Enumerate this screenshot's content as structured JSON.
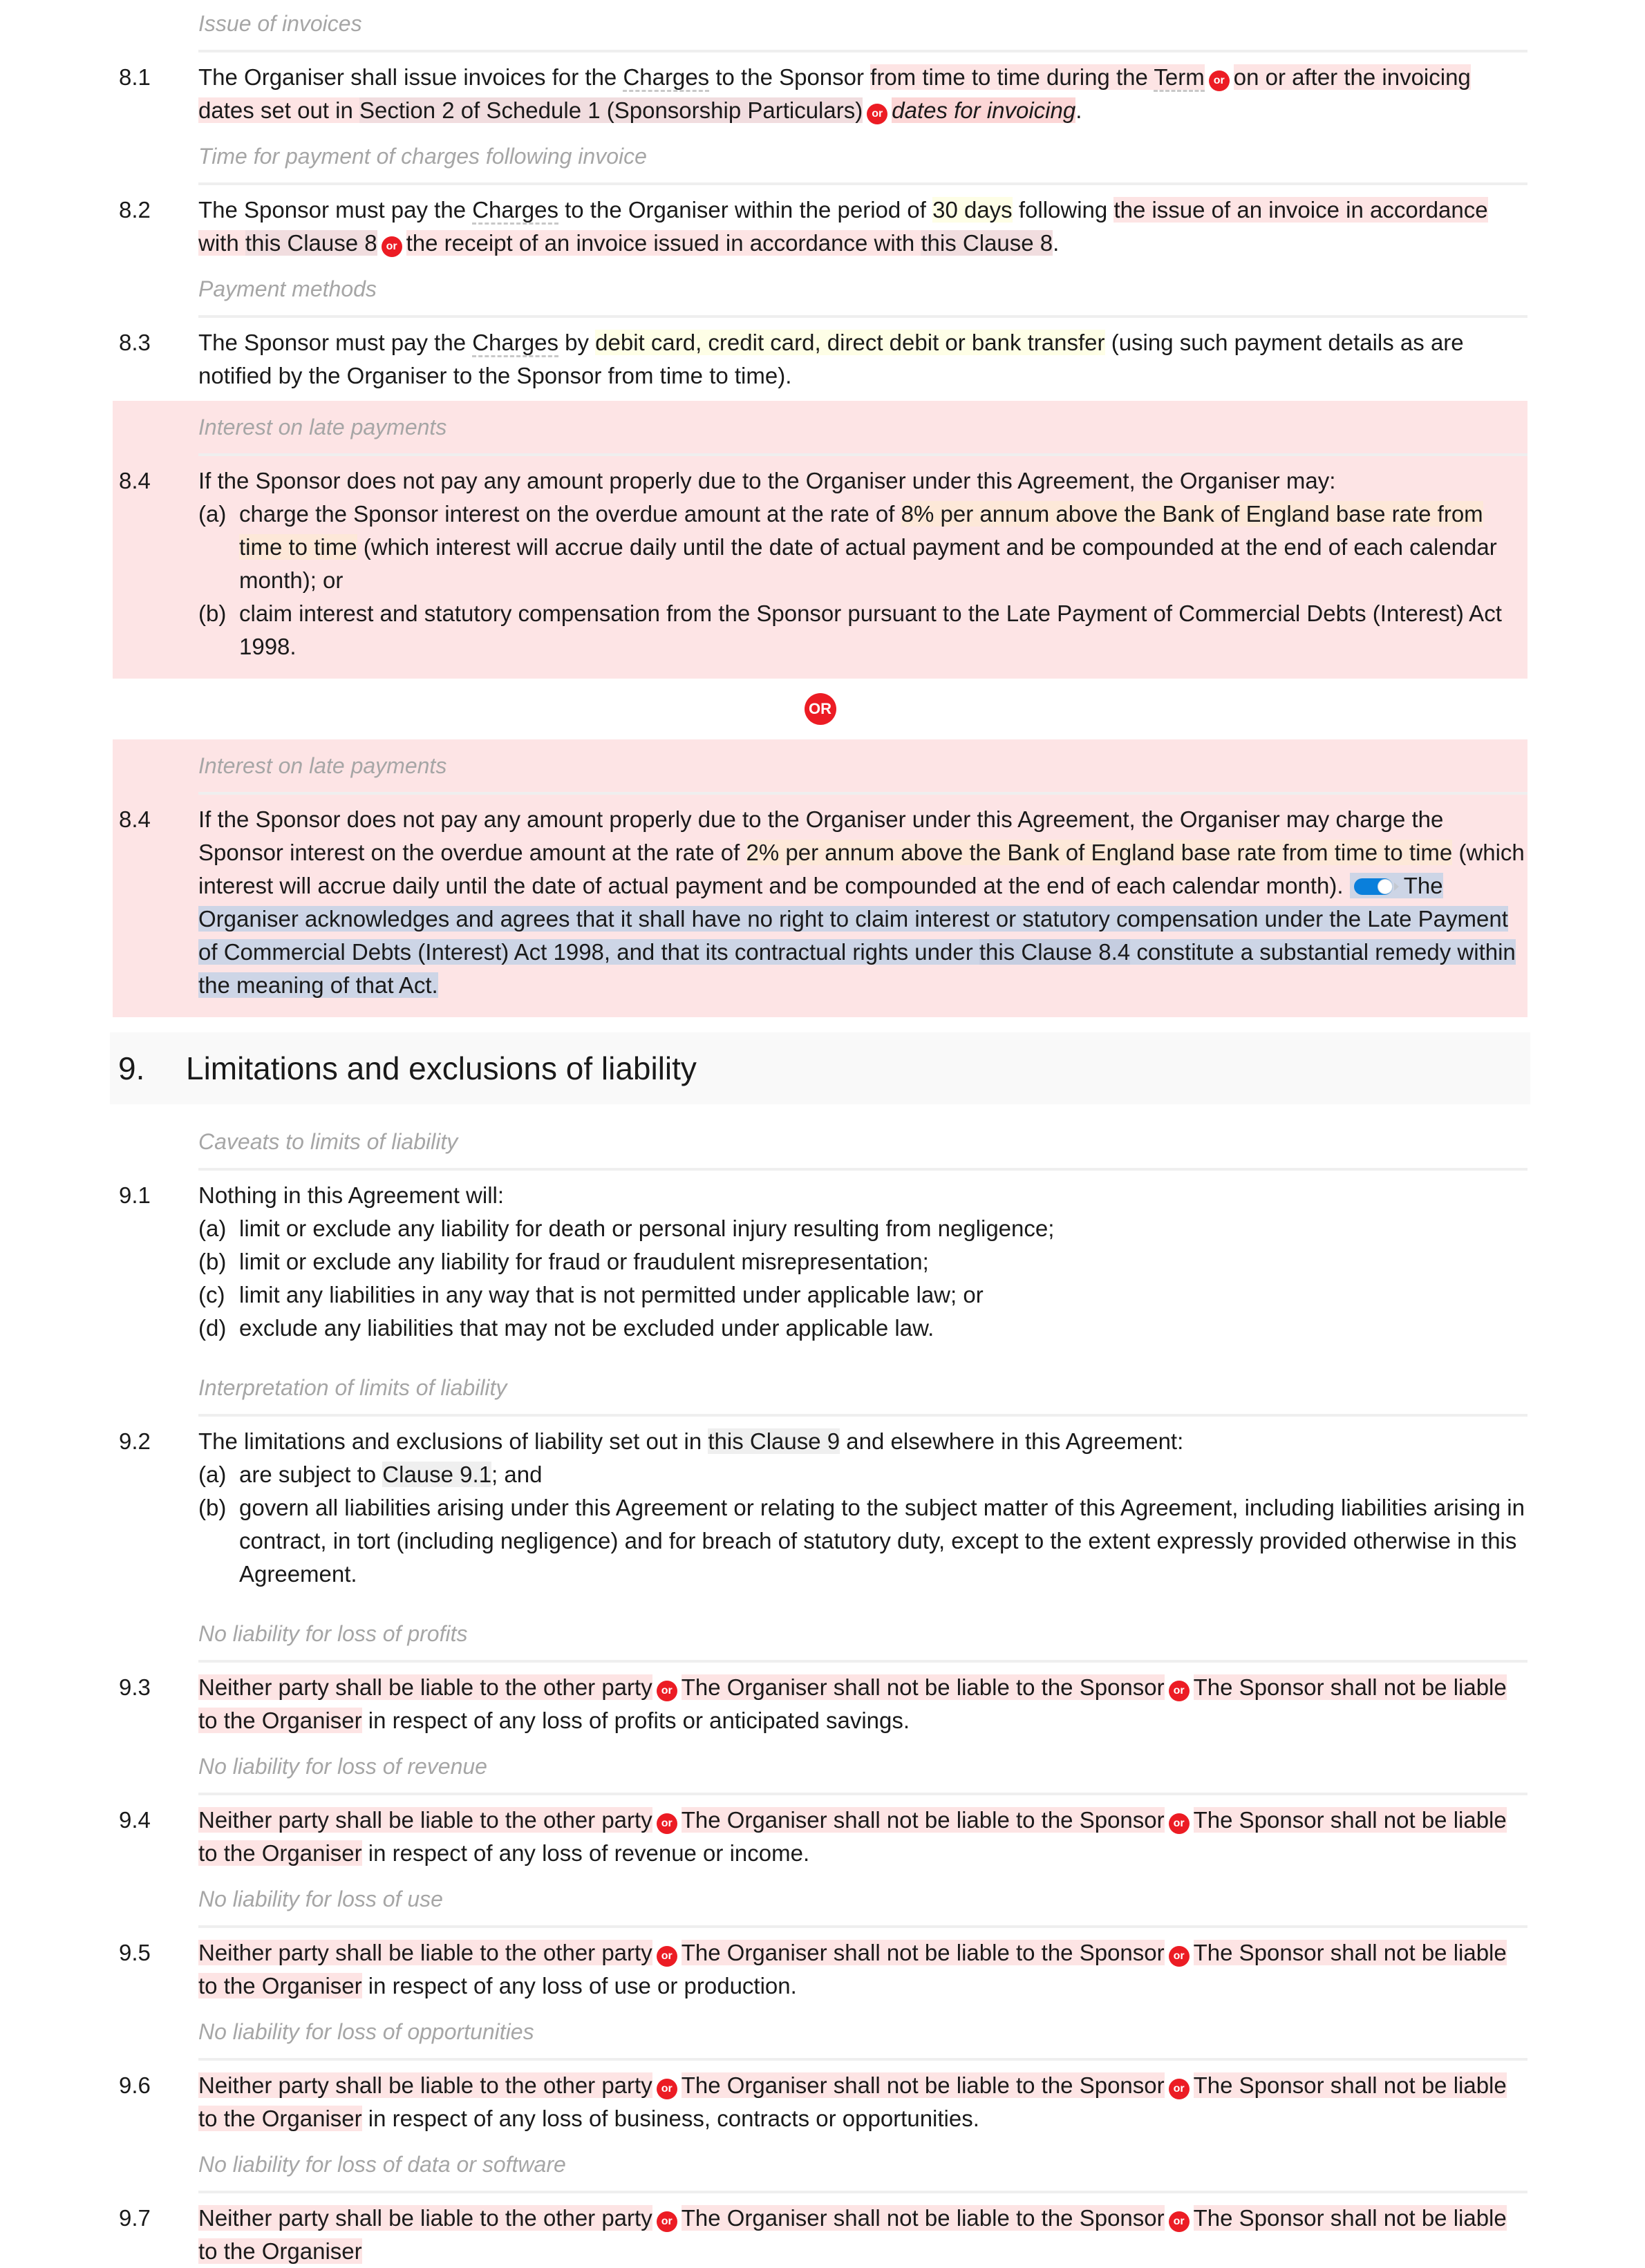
{
  "colors": {
    "option_bg": "#fde4e4",
    "or_badge": "#ec1c24",
    "variable_bg": "#fefee6",
    "rate_bg": "#fde8d8",
    "reference_bg": "#efefef",
    "optional_block_bg": "#fde4e5",
    "toggle_on": "#0a7fdb",
    "toggled_text_bg": "#cdd5e6"
  },
  "or_label": "or",
  "or_big_label": "OR",
  "c81": {
    "heading": "Issue of invoices",
    "num": "8.1",
    "t1": "The Organiser shall issue invoices for the ",
    "charges": "Charges",
    "t2": " to the Sponsor ",
    "opt1": "from time to time during the ",
    "term": "Term",
    "opt2a": "on or after the invoicing dates set out in ",
    "opt2ref": "Section 2 of Schedule 1 (Sponsorship Particulars)",
    "opt3": "dates for invoicing",
    "end": "."
  },
  "c82": {
    "heading": "Time for payment of charges following invoice",
    "num": "8.2",
    "t1": "The Sponsor must pay the ",
    "charges": "Charges",
    "t2": " to the Organiser within the period of ",
    "days": "30 days",
    "t3": " following ",
    "opt1a": "the issue of an invoice in accordance with ",
    "opt1ref": "this Clause 8",
    "opt2a": "the receipt of an invoice issued in accordance with ",
    "opt2ref": "this Clause 8",
    "end": "."
  },
  "c83": {
    "heading": "Payment methods",
    "num": "8.3",
    "t1": "The Sponsor must pay the ",
    "charges": "Charges",
    "t2": " by ",
    "methods": "debit card, credit card, direct debit or bank transfer",
    "t3": " (using such payment details as are notified by the Organiser to the Sponsor from time to time)."
  },
  "c84a": {
    "heading": "Interest on late payments",
    "num": "8.4",
    "intro": "If the Sponsor does not pay any amount properly due to the Organiser under this Agreement, the Organiser may:",
    "a_label": "(a)",
    "a1": "charge the Sponsor interest on the overdue amount at the rate of ",
    "a_rate": "8% per annum above the Bank of England base rate from time to time",
    "a2": " (which interest will accrue daily until the date of actual payment and be compounded at the end of each calendar month); or",
    "b_label": "(b)",
    "b": "claim interest and statutory compensation from the Sponsor pursuant to the Late Payment of Commercial Debts (Interest) Act 1998."
  },
  "c84b": {
    "heading": "Interest on late payments",
    "num": "8.4",
    "t1": "If the Sponsor does not pay any amount properly due to the Organiser under this Agreement, the Organiser may charge the Sponsor interest on the overdue amount at the rate of ",
    "rate": "2% per annum above the Bank of England base rate from time to time",
    "t2": " (which interest will accrue daily until the date of actual payment and be compounded at the end of each calendar month). ",
    "toggle_on": true,
    "opt1": "The Organiser acknowledges and agrees that it shall have no right to claim interest or statutory compensation under the Late Payment of Commercial Debts (Interest) Act 1998, and that its contractual rights under ",
    "optref": "this Clause 8.4",
    "opt2": " constitute a substantial remedy within the meaning of that Act."
  },
  "section9": {
    "num": "9.",
    "title": "Limitations and exclusions of liability"
  },
  "c91": {
    "heading": "Caveats to limits of liability",
    "num": "9.1",
    "intro": "Nothing in this Agreement will:",
    "items": [
      {
        "label": "(a)",
        "text": "limit or exclude any liability for death or personal injury resulting from negligence;"
      },
      {
        "label": "(b)",
        "text": "limit or exclude any liability for fraud or fraudulent misrepresentation;"
      },
      {
        "label": "(c)",
        "text": "limit any liabilities in any way that is not permitted under applicable law; or"
      },
      {
        "label": "(d)",
        "text": "exclude any liabilities that may not be excluded under applicable law."
      }
    ]
  },
  "c92": {
    "heading": "Interpretation of limits of liability",
    "num": "9.2",
    "t1": "The limitations and exclusions of liability set out in ",
    "ref": "this Clause 9",
    "t2": " and elsewhere in this Agreement:",
    "a_label": "(a)",
    "a1": "are subject to ",
    "a_ref": "Clause 9.1",
    "a2": "; and",
    "b_label": "(b)",
    "b": "govern all liabilities arising under this Agreement or relating to the subject matter of this Agreement, including liabilities arising in contract, in tort (including negligence) and for breach of statutory duty, except to the extent expressly provided otherwise in this Agreement."
  },
  "party_options": {
    "o1": "Neither party shall be liable to the other party",
    "o2": "The Organiser shall not be liable to the Sponsor",
    "o3": "The Sponsor shall not be liable to the Organiser"
  },
  "c93": {
    "heading": "No liability for loss of profits",
    "num": "9.3",
    "tail": " in respect of any loss of profits or anticipated savings."
  },
  "c94": {
    "heading": "No liability for loss of revenue",
    "num": "9.4",
    "tail": " in respect of any loss of revenue or income."
  },
  "c95": {
    "heading": "No liability for loss of use",
    "num": "9.5",
    "tail": " in respect of any loss of use or production."
  },
  "c96": {
    "heading": "No liability for loss of opportunities",
    "num": "9.6",
    "tail": " in respect of any loss of business, contracts or opportunities."
  },
  "c97": {
    "heading": "No liability for loss of data or software",
    "num": "9.7"
  }
}
